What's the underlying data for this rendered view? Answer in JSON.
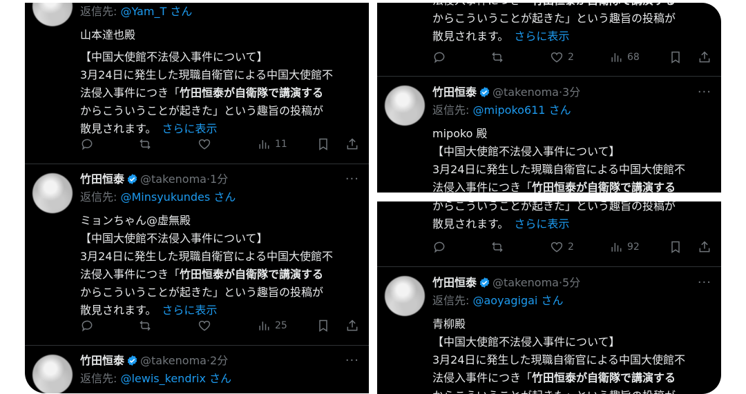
{
  "tweet_common": {
    "name": "竹田恒泰",
    "handle": "@takenoma",
    "reply_prefix": "返信先: ",
    "reply_suffix": " さん",
    "heading": "【中国大使館不法侵入事件について】",
    "line1": "3月24日に発生した現職自衛官による中国大使館不",
    "line2_pre": "法侵入事件につき「",
    "line2_bold": "竹田恒泰が自衛隊で講演する",
    "line3": "からこういうことが起きた」という趣旨の投稿が",
    "line4": "散見されます。",
    "show_more": "さらに表示",
    "more_glyph": "···"
  },
  "left_panel": {
    "tweet1": {
      "reply_to": "@Yam_T",
      "greeting": "山本達也殿",
      "views": "11"
    },
    "tweet2": {
      "time": "1分",
      "reply_to": "@Minsyukundes",
      "greeting": "ミョンちゃん@虚無殿",
      "views": "25"
    },
    "tweet3": {
      "time": "2分",
      "reply_to": "@lewis_kendrix"
    }
  },
  "right_top_panel": {
    "tweet1": {
      "likes": "2",
      "views": "68"
    },
    "tweet2": {
      "time": "3分",
      "reply_to": "@mipoko611",
      "greeting": "mipoko 殿"
    }
  },
  "right_bottom_panel": {
    "tweet1": {
      "likes": "2",
      "views": "92"
    },
    "tweet2": {
      "time": "5分",
      "reply_to": "@aoyagigai",
      "greeting": "青柳殿"
    }
  },
  "colors": {
    "background": "#000000",
    "text": "#e7e9ea",
    "muted": "#71767b",
    "link": "#1d9bf0",
    "separator": "#2f3336"
  }
}
